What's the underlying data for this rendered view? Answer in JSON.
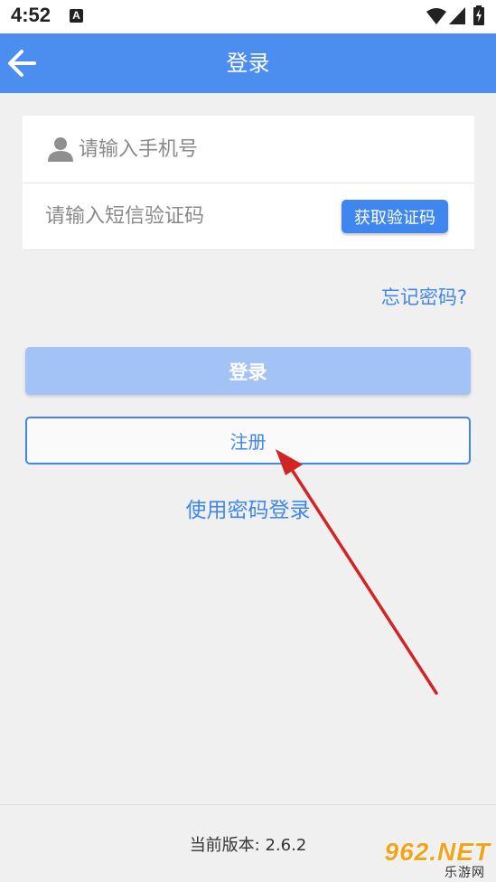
{
  "status_bar": {
    "time": "4:52",
    "notification_letter": "A",
    "icons": [
      "a-notification-icon",
      "wifi-icon",
      "signal-icon",
      "battery-charging-icon"
    ]
  },
  "header": {
    "title": "登录",
    "back_icon": "arrow-left-icon",
    "color": "#4b8ef0"
  },
  "form": {
    "phone": {
      "placeholder": "请输入手机号",
      "value": "",
      "icon": "user-icon"
    },
    "sms_code": {
      "placeholder": "请输入短信验证码",
      "value": ""
    },
    "get_code_label": "获取验证码"
  },
  "links": {
    "forgot_password": "忘记密码?",
    "password_login": "使用密码登录"
  },
  "buttons": {
    "login": "登录",
    "register": "注册"
  },
  "footer": {
    "version_label": "当前版本:",
    "version_value": "2.6.2"
  },
  "watermark": {
    "main": "962.NET",
    "sub": "乐游网"
  },
  "colors": {
    "accent": "#3f87ee",
    "login_disabled": "#a3c2f6",
    "annotation_arrow": "#d32424"
  }
}
